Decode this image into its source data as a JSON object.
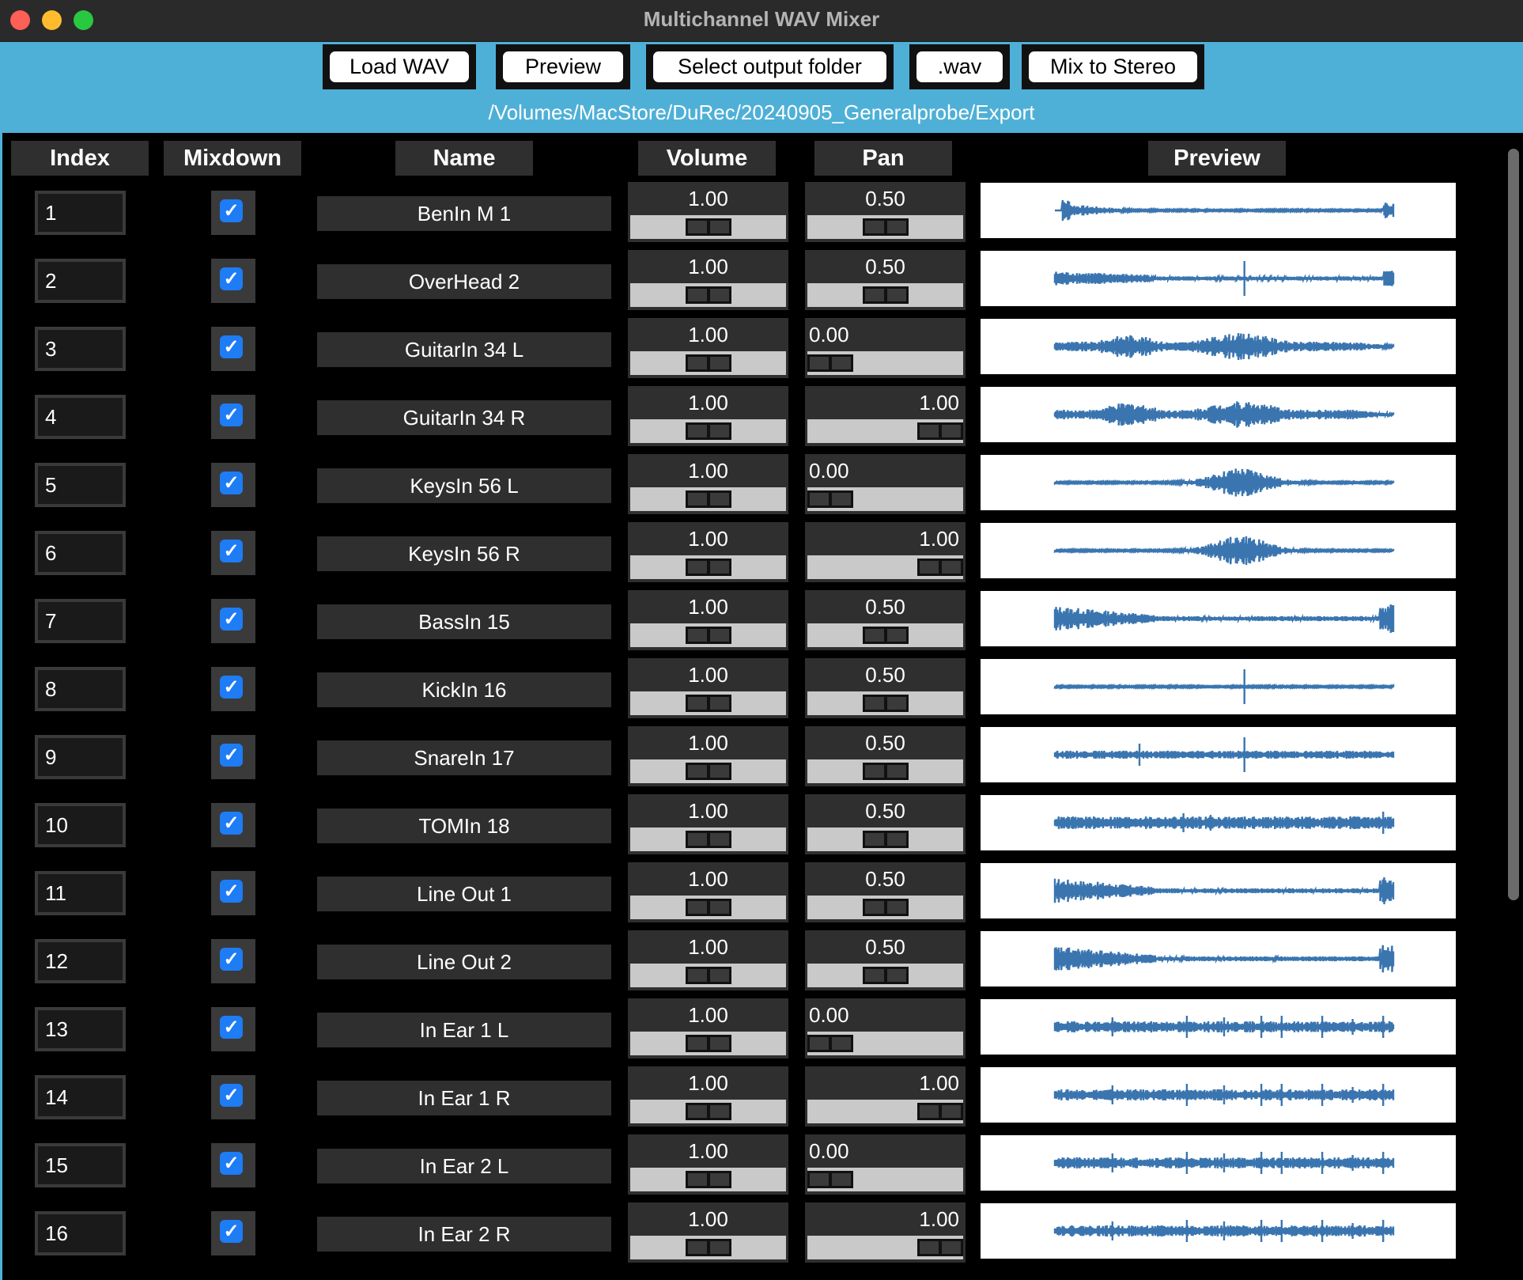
{
  "window": {
    "title": "Multichannel WAV Mixer"
  },
  "toolbar": {
    "buttons": [
      {
        "label": "Load WAV"
      },
      {
        "label": "Preview"
      },
      {
        "label": "Select output folder"
      },
      {
        "label": ".wav"
      },
      {
        "label": "Mix to Stereo"
      }
    ],
    "output_path": "/Volumes/MacStore/DuRec/20240905_Generalprobe/Export"
  },
  "columns": [
    "Index",
    "Mixdown",
    "Name",
    "Volume",
    "Pan",
    "Preview"
  ],
  "channels": [
    {
      "index": "1",
      "mixdown": true,
      "name": "BenIn M 1",
      "volume": "1.00",
      "pan": "0.50",
      "wave": "kick_end"
    },
    {
      "index": "2",
      "mixdown": true,
      "name": "OverHead 2",
      "volume": "1.00",
      "pan": "0.50",
      "wave": "overhead"
    },
    {
      "index": "3",
      "mixdown": true,
      "name": "GuitarIn 34 L",
      "volume": "1.00",
      "pan": "0.00",
      "wave": "guitar"
    },
    {
      "index": "4",
      "mixdown": true,
      "name": "GuitarIn 34 R",
      "volume": "1.00",
      "pan": "1.00",
      "wave": "guitar"
    },
    {
      "index": "5",
      "mixdown": true,
      "name": "KeysIn 56 L",
      "volume": "1.00",
      "pan": "0.00",
      "wave": "keys"
    },
    {
      "index": "6",
      "mixdown": true,
      "name": "KeysIn 56 R",
      "volume": "1.00",
      "pan": "1.00",
      "wave": "keys"
    },
    {
      "index": "7",
      "mixdown": true,
      "name": "BassIn 15",
      "volume": "1.00",
      "pan": "0.50",
      "wave": "bass"
    },
    {
      "index": "8",
      "mixdown": true,
      "name": "KickIn 16",
      "volume": "1.00",
      "pan": "0.50",
      "wave": "kick"
    },
    {
      "index": "9",
      "mixdown": true,
      "name": "SnareIn 17",
      "volume": "1.00",
      "pan": "0.50",
      "wave": "snare"
    },
    {
      "index": "10",
      "mixdown": true,
      "name": "TOMIn 18",
      "volume": "1.00",
      "pan": "0.50",
      "wave": "tom"
    },
    {
      "index": "11",
      "mixdown": true,
      "name": "Line Out 1",
      "volume": "1.00",
      "pan": "0.50",
      "wave": "bass"
    },
    {
      "index": "12",
      "mixdown": true,
      "name": "Line Out 2",
      "volume": "1.00",
      "pan": "0.50",
      "wave": "bass"
    },
    {
      "index": "13",
      "mixdown": true,
      "name": "In Ear 1 L",
      "volume": "1.00",
      "pan": "0.00",
      "wave": "inear"
    },
    {
      "index": "14",
      "mixdown": true,
      "name": "In Ear 1 R",
      "volume": "1.00",
      "pan": "1.00",
      "wave": "inear"
    },
    {
      "index": "15",
      "mixdown": true,
      "name": "In Ear 2 L",
      "volume": "1.00",
      "pan": "0.00",
      "wave": "inear"
    },
    {
      "index": "16",
      "mixdown": true,
      "name": "In Ear 2 R",
      "volume": "1.00",
      "pan": "1.00",
      "wave": "inear"
    }
  ],
  "colors": {
    "toolbar_bg": "#4fb0d7",
    "waveform": "#3a75b0",
    "checkbox": "#1e7cf5"
  },
  "icons": {
    "checkbox": "checkmark-icon"
  }
}
